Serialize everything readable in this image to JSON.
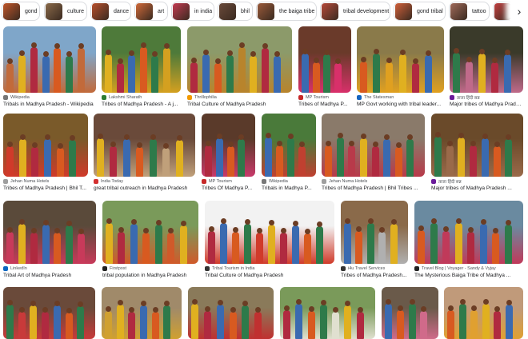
{
  "chips": [
    {
      "label": "gond",
      "color": "#c0562a"
    },
    {
      "label": "culture",
      "color": "#8a6a4a"
    },
    {
      "label": "dance",
      "color": "#b8502c"
    },
    {
      "label": "art",
      "color": "#d06a3a"
    },
    {
      "label": "in india",
      "color": "#c43c52"
    },
    {
      "label": "bhil",
      "color": "#6a4a3a"
    },
    {
      "label": "the baiga tribe",
      "color": "#9a5a3a"
    },
    {
      "label": "tribal development",
      "color": "#b64a3a"
    },
    {
      "label": "gond tribal",
      "color": "#d0603a"
    },
    {
      "label": "tattoo",
      "color": "#a06a5a"
    },
    {
      "label": "",
      "color": "#c04040"
    }
  ],
  "results": [
    {
      "source": "Wikipedia",
      "title": "Tribals in Madhya Pradesh - Wikipedia",
      "fav": "#777777",
      "bg": [
        "#7fa6c9",
        "#c26a3a"
      ]
    },
    {
      "source": "Lakshmi Sharath",
      "title": "Tribes of Madhya Pradesh - A j...",
      "fav": "#2e7d32",
      "bg": [
        "#4e7a3a",
        "#d4a020"
      ]
    },
    {
      "source": "Thrillophilia",
      "title": "Tribal Culture of Madhya Pradesh",
      "fav": "#f29900",
      "bg": [
        "#8c9a6a",
        "#b8842c"
      ]
    },
    {
      "source": "MP Tourism",
      "title": "Tribes of Madhya P...",
      "fav": "#c62828",
      "bg": [
        "#6a3a2a",
        "#d8306a"
      ]
    },
    {
      "source": "The Statesman",
      "title": "MP Govt working with tribal leader...",
      "fav": "#1565c0",
      "bg": [
        "#8a7a4a",
        "#e0a020"
      ]
    },
    {
      "source": "ताजा हिंदी सन्न",
      "title": "Major tribes of Madhya Pradesh",
      "fav": "#6a1b9a",
      "bg": [
        "#3a3a2a",
        "#c06a8a"
      ]
    },
    {
      "source": "Jehan Numa Hotels",
      "title": "Tribes of Madhya Pradesh | Bhil T...",
      "fav": "#9e9e9e",
      "bg": [
        "#7a5a2a",
        "#d03a2a"
      ]
    },
    {
      "source": "India Today",
      "title": "great tribal outreach in Madhya Pradesh",
      "fav": "#d32f2f",
      "bg": [
        "#6a4a3a",
        "#c0a07a"
      ]
    },
    {
      "source": "MP Tourism",
      "title": "Tribes Of Madhya P...",
      "fav": "#c62828",
      "bg": [
        "#5a3a2a",
        "#c83a6a"
      ]
    },
    {
      "source": "Wikipedia",
      "title": "Tribals in Madhya P...",
      "fav": "#777777",
      "bg": [
        "#4a7a3a",
        "#c04030"
      ]
    },
    {
      "source": "Jehan Numa Hotels",
      "title": "Tribes of Madhya Pradesh | Bhil Tribes ...",
      "fav": "#9e9e9e",
      "bg": [
        "#8a7a6a",
        "#b83a4a"
      ]
    },
    {
      "source": "ताजा हिंदी सन्न",
      "title": "Major tribes of Madhya Pradesh ...",
      "fav": "#6a1b9a",
      "bg": [
        "#6a4a2a",
        "#9a6a4a"
      ]
    },
    {
      "source": "LinkedIn",
      "title": "Tribal Art of Madhya Pradesh",
      "fav": "#0a66c2",
      "bg": [
        "#5a4a3a",
        "#c83a5a"
      ]
    },
    {
      "source": "Firstpost",
      "title": "tribal population in Madhya Pradesh",
      "fav": "#222222",
      "bg": [
        "#7a9a5a",
        "#d05a2a"
      ]
    },
    {
      "source": "Tribal Tourism in India",
      "title": "Tribal Culture of Madhya Pradesh",
      "fav": "#333333",
      "bg": [
        "#f2f2f2",
        "#d03a2a"
      ]
    },
    {
      "source": "i4u Travel Services",
      "title": "Tribes of Madhya Pradesh...",
      "fav": "#333333",
      "bg": [
        "#8a6a4a",
        "#b0b0b0"
      ]
    },
    {
      "source": "Travel Blog | Voyager - Sandy & Vyjay",
      "title": "The Mysterious Baiga Tribe of Madhya ...",
      "fav": "#222222",
      "bg": [
        "#6a8aa0",
        "#c03a5a"
      ]
    },
    {
      "bg": [
        "#6a4a3a",
        "#c83a3a"
      ]
    },
    {
      "bg": [
        "#a08a6a",
        "#d0a030"
      ]
    },
    {
      "bg": [
        "#8a7a5a",
        "#c03030"
      ]
    },
    {
      "bg": [
        "#7a9a5a",
        "#e0e0d0"
      ]
    },
    {
      "bg": [
        "#6a5a4a",
        "#d06a8a"
      ]
    },
    {
      "bg": [
        "#c09a7a",
        "#e0a030"
      ]
    }
  ]
}
